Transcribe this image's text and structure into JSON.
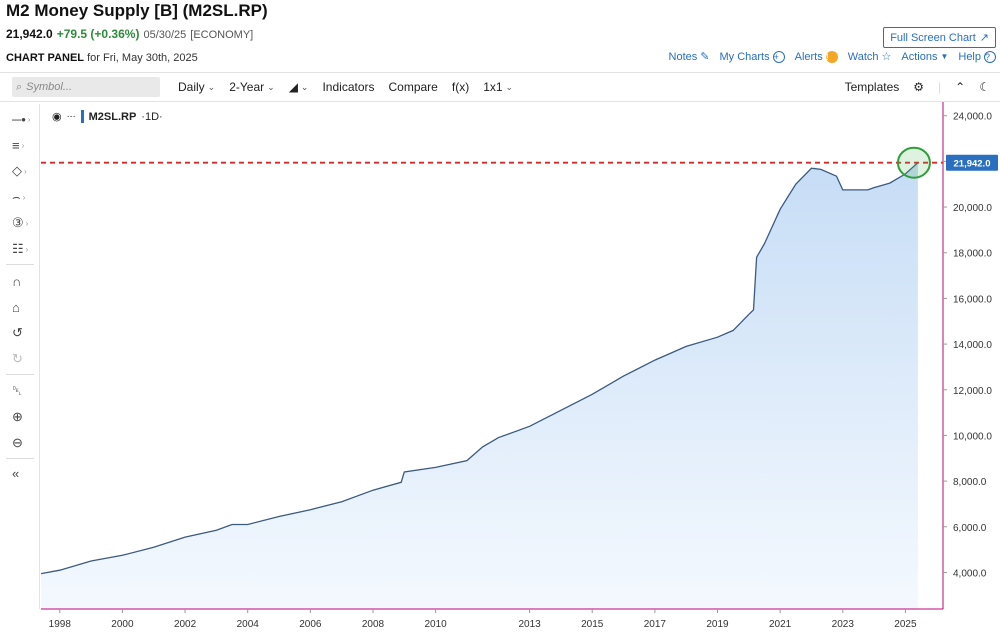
{
  "header": {
    "title": "M2 Money Supply [B] (M2SL.RP)",
    "price": "21,942.0",
    "change": "+79.5 (+0.36%)",
    "date": "05/30/25",
    "tag": "[ECONOMY]",
    "full_screen_label": "Full Screen Chart"
  },
  "panel": {
    "label": "CHART PANEL",
    "for_text": "for Fri, May 30th, 2025",
    "links": {
      "notes": "Notes",
      "my_charts": "My Charts",
      "alerts": "Alerts",
      "watch": "Watch",
      "actions": "Actions",
      "help": "Help"
    }
  },
  "toolbar": {
    "search_placeholder": "Symbol...",
    "interval": "Daily",
    "range": "2-Year",
    "indicators": "Indicators",
    "compare": "Compare",
    "fx": "f(x)",
    "layout": "1x1",
    "templates": "Templates"
  },
  "legend": {
    "symbol": "M2SL.RP",
    "interval": "·1D·"
  },
  "colors": {
    "accent": "#2a6fc0",
    "line": "#3b5a80",
    "fill_top": "#c3dbf5",
    "marker": "#2e9e3a",
    "ref_line": "#d62828",
    "axis_line": "#c0007a"
  },
  "chart_data": {
    "type": "area",
    "title": "M2 Money Supply [B] (M2SL.RP)",
    "xlabel": "",
    "ylabel": "",
    "ylim": [
      2400,
      24600
    ],
    "xlim": [
      1997.4,
      2026.2
    ],
    "x_ticks": [
      1998,
      2000,
      2002,
      2004,
      2006,
      2008,
      2010,
      2013,
      2015,
      2017,
      2019,
      2021,
      2023,
      2025
    ],
    "y_ticks": [
      4000,
      6000,
      8000,
      10000,
      12000,
      14000,
      16000,
      18000,
      20000,
      22000,
      24000
    ],
    "y_tick_labels": [
      "4,000.0",
      "6,000.0",
      "8,000.0",
      "10,000.0",
      "12,000.0",
      "14,000.0",
      "16,000.0",
      "18,000.0",
      "20,000.0",
      "",
      "24,000.0"
    ],
    "last_value_label": "21,942.0",
    "reference_line": 21942,
    "series": [
      {
        "x": [
          1997.4,
          1998,
          1999,
          2000,
          2001,
          2002,
          2003,
          2003.5,
          2004,
          2005,
          2006,
          2007,
          2008,
          2008.9,
          2009,
          2010,
          2011,
          2011.5,
          2012,
          2013,
          2014,
          2015,
          2016,
          2017,
          2018,
          2019,
          2019.5,
          2020,
          2020.15,
          2020.25,
          2020.5,
          2021,
          2021.5,
          2022,
          2022.3,
          2022.8,
          2023,
          2023.4,
          2023.8,
          2024,
          2024.5,
          2025,
          2025.4
        ],
        "y": [
          3950,
          4100,
          4500,
          4750,
          5100,
          5550,
          5850,
          6100,
          6100,
          6450,
          6750,
          7100,
          7600,
          7950,
          8400,
          8600,
          8900,
          9500,
          9900,
          10400,
          11100,
          11800,
          12600,
          13300,
          13900,
          14300,
          14600,
          15300,
          15500,
          17800,
          18400,
          19900,
          21000,
          21700,
          21650,
          21350,
          20750,
          20750,
          20750,
          20850,
          21050,
          21450,
          21942
        ]
      }
    ]
  }
}
